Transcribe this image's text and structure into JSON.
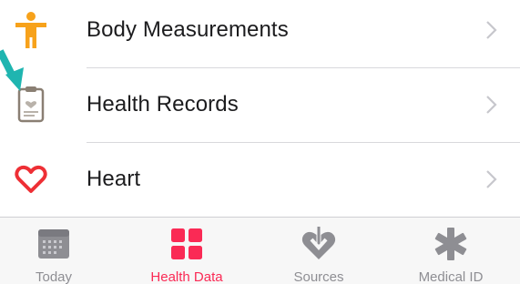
{
  "list": {
    "items": [
      {
        "label": "Body Measurements",
        "icon": "person-figure-icon",
        "icon_color": "#f7a21b"
      },
      {
        "label": "Health Records",
        "icon": "clipboard-icon",
        "icon_color": "#8a7f73"
      },
      {
        "label": "Heart",
        "icon": "heart-icon",
        "icon_color": "#ee2f35"
      }
    ],
    "chevron_icon": "chevron-right-icon"
  },
  "annotation": {
    "icon": "teal-arrow-icon",
    "color": "#1fb5b0"
  },
  "tabbar": {
    "tabs": [
      {
        "label": "Today",
        "icon": "calendar-icon",
        "active": false
      },
      {
        "label": "Health Data",
        "icon": "grid-squares-icon",
        "active": true
      },
      {
        "label": "Sources",
        "icon": "heart-download-icon",
        "active": false
      },
      {
        "label": "Medical ID",
        "icon": "asterisk-icon",
        "active": false
      }
    ],
    "active_color": "#fa2a55",
    "inactive_color": "#8e8e93"
  }
}
